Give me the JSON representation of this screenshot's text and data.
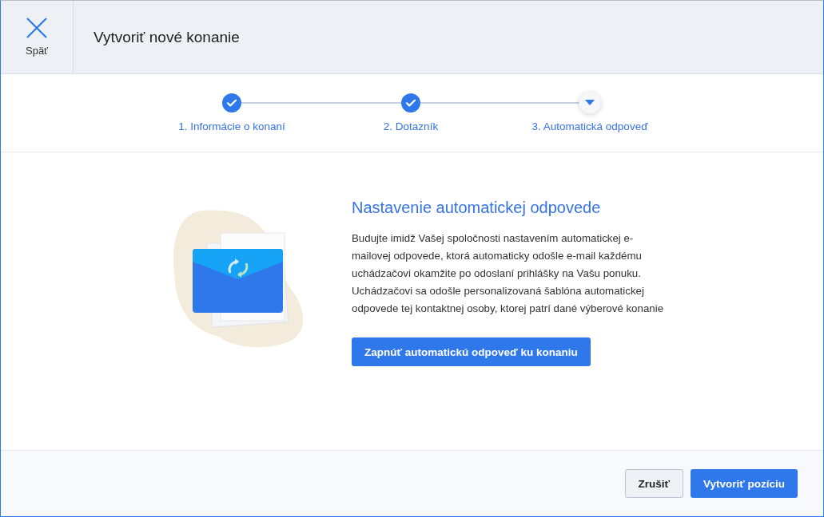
{
  "header": {
    "close_label": "Späť",
    "title": "Vytvoriť nové konanie"
  },
  "steps": [
    {
      "label": "1. Informácie o konaní",
      "kind": "done"
    },
    {
      "label": "2. Dotazník",
      "kind": "done"
    },
    {
      "label": "3. Automatická odpoveď",
      "kind": "current"
    }
  ],
  "content": {
    "title": "Nastavenie automatickej odpovede",
    "description_lines": [
      "Budujte imidž Vašej spoločnosti nastavením automatickej e-",
      "mailovej odpovede, ktorá automaticky odošle e-mail každému",
      "uchádzačovi okamžite po odoslaní prihlášky na Vašu ponuku.",
      "Uchádzačovi sa odošle personalizovaná šablóna automatickej",
      "odpovede tej kontaktnej osoby, ktorej patrí dané výberové konanie"
    ],
    "button": "Zapnúť automatickú odpoveď ku konaniu"
  },
  "footer": {
    "buttons": [
      {
        "label": "Zrušiť",
        "kind": "secondary"
      },
      {
        "label": "Vytvoriť pozíciu",
        "kind": "primary"
      }
    ]
  }
}
